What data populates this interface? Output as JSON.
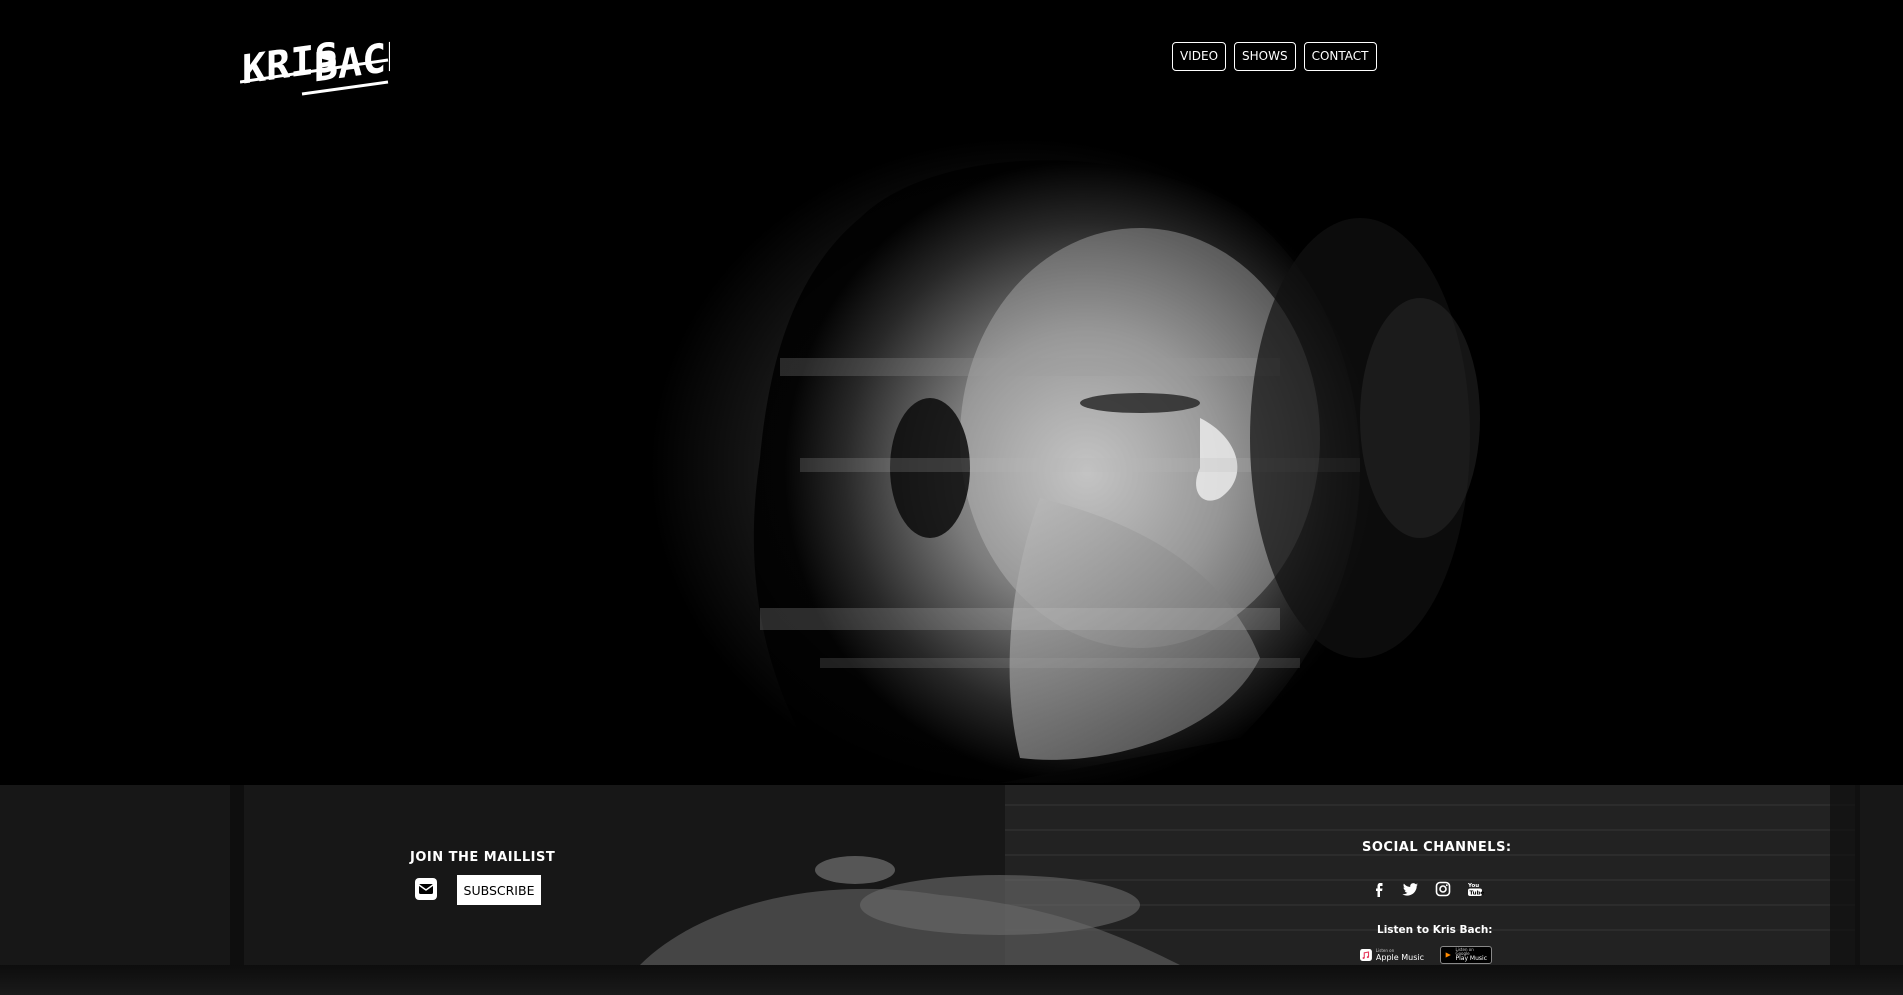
{
  "brand": {
    "logo_text_1": "KRIS",
    "logo_text_2": "BACH"
  },
  "nav": {
    "items": [
      {
        "label": "VIDEO"
      },
      {
        "label": "SHOWS"
      },
      {
        "label": "CONTACT"
      }
    ]
  },
  "footer": {
    "maillist_title": "JOIN THE MAILLIST",
    "subscribe_label": "SUBSCRIBE",
    "social_title": "SOCIAL CHANNELS:",
    "social_icons": [
      "facebook-icon",
      "twitter-icon",
      "instagram-icon",
      "youtube-icon"
    ],
    "listen_title": "Listen to Kris Bach:",
    "badges": {
      "apple_small": "Listen on",
      "apple_big": "Apple Music",
      "google_small": "Listen on Google",
      "google_big": "Play Music"
    }
  },
  "colors": {
    "background": "#000000",
    "footer_band": "#1a1a1a",
    "text": "#ffffff"
  }
}
